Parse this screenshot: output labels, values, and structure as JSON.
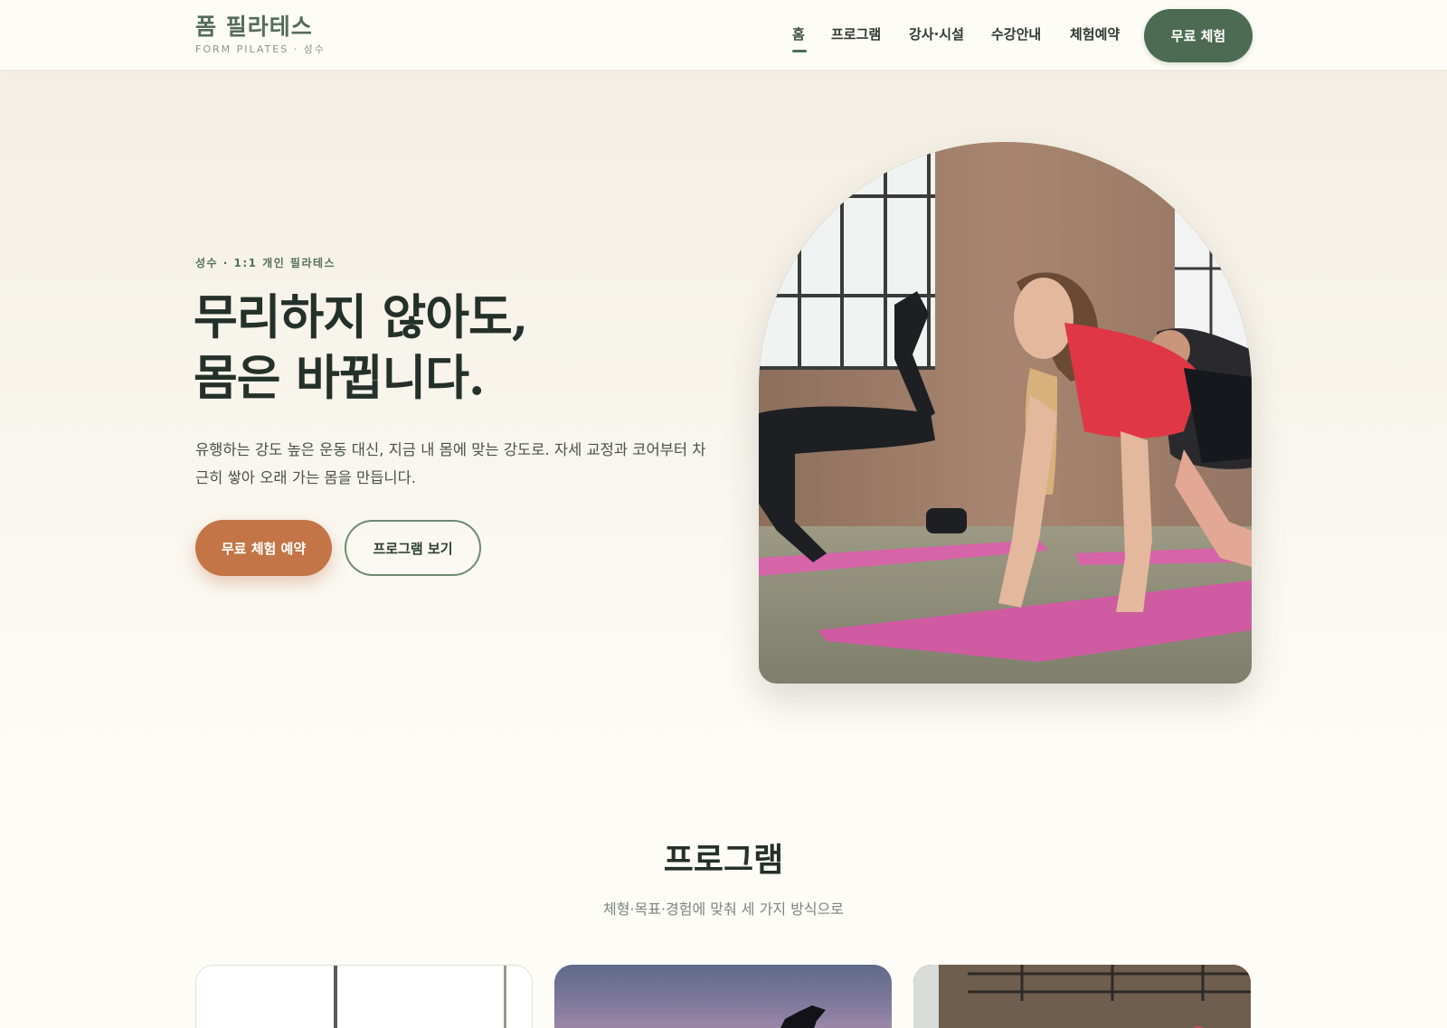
{
  "brand": {
    "title": "폼 필라테스",
    "subtitle": "FORM PILATES · 성수"
  },
  "nav": {
    "items": [
      {
        "label": "홈",
        "active": true
      },
      {
        "label": "프로그램",
        "active": false
      },
      {
        "label": "강사·시설",
        "active": false
      },
      {
        "label": "수강안내",
        "active": false
      },
      {
        "label": "체험예약",
        "active": false
      }
    ],
    "cta_label": "무료 체험"
  },
  "hero": {
    "eyebrow": "성수 · 1:1 개인 필라테스",
    "title_line1": "무리하지 않아도,",
    "title_line2": "몸은 바뀝니다.",
    "description": "유행하는 강도 높은 운동 대신, 지금 내 몸에 맞는 강도로. 자세 교정과 코어부터 차근히 쌓아 오래 가는 몸을 만듭니다.",
    "primary_button": "무료 체험 예약",
    "secondary_button": "프로그램 보기"
  },
  "programs": {
    "title": "프로그램",
    "subtitle": "체형·목표·경험에 맞춰 세 가지 방식으로"
  },
  "colors": {
    "accent_green": "#4c6b52",
    "accent_terracotta": "#c37547",
    "background": "#fdfcf7"
  }
}
